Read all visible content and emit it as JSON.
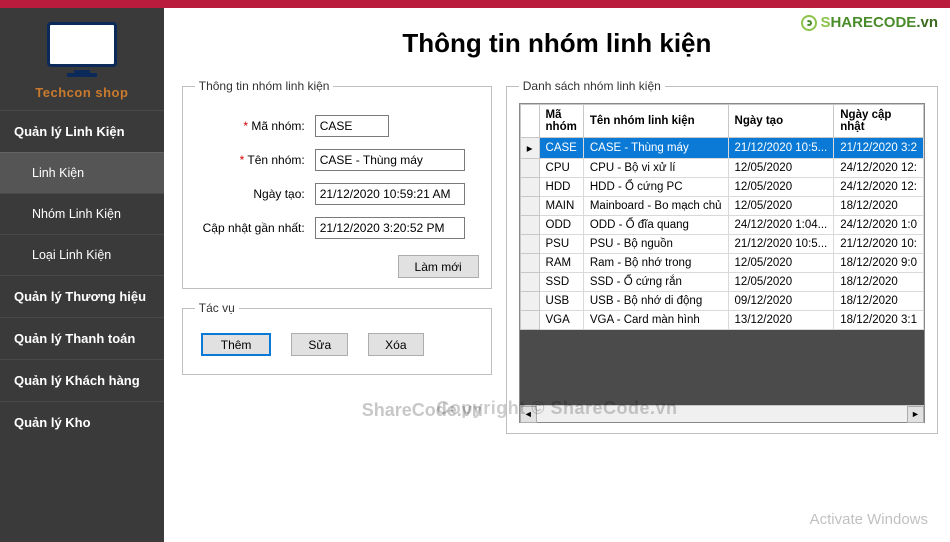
{
  "brand": {
    "name": "Techcon shop"
  },
  "sidebar_items": [
    {
      "label": "Quản lý Linh Kiện",
      "indent": false,
      "active": false
    },
    {
      "label": "Linh Kiện",
      "indent": true,
      "active": true
    },
    {
      "label": "Nhóm Linh Kiện",
      "indent": true,
      "active": false
    },
    {
      "label": "Loại Linh Kiện",
      "indent": true,
      "active": false
    },
    {
      "label": "Quản lý Thương hiệu",
      "indent": false,
      "active": false
    },
    {
      "label": "Quản lý Thanh toán",
      "indent": false,
      "active": false
    },
    {
      "label": "Quản lý Khách hàng",
      "indent": false,
      "active": false
    },
    {
      "label": "Quản lý Kho",
      "indent": false,
      "active": false
    }
  ],
  "page_title": "Thông tin nhóm linh kiện",
  "form": {
    "legend": "Thông tin nhóm linh kiện",
    "labels": {
      "ma": "Mã nhóm:",
      "ten": "Tên nhóm:",
      "ngaytao": "Ngày tạo:",
      "capnhat": "Cập nhật gần nhất:"
    },
    "values": {
      "ma": "CASE",
      "ten": "CASE - Thùng máy",
      "ngaytao": "21/12/2020 10:59:21 AM",
      "capnhat": "21/12/2020 3:20:52 PM"
    },
    "refresh_label": "Làm mới"
  },
  "tasks": {
    "legend": "Tác vụ",
    "add": "Thêm",
    "edit": "Sửa",
    "delete": "Xóa"
  },
  "grid": {
    "legend": "Danh sách nhóm linh kiện",
    "columns": {
      "ma": "Mã nhóm",
      "ten": "Tên nhóm linh kiện",
      "ngaytao": "Ngày tạo",
      "ngaycap": "Ngày cập nhật"
    },
    "rows": [
      {
        "ma": "CASE",
        "ten": "CASE - Thùng máy",
        "ngaytao": "21/12/2020 10:5...",
        "ngaycap": "21/12/2020 3:2",
        "sel": true
      },
      {
        "ma": "CPU",
        "ten": "CPU - Bộ vi xử lí",
        "ngaytao": "12/05/2020",
        "ngaycap": "24/12/2020 12:"
      },
      {
        "ma": "HDD",
        "ten": "HDD - Ổ cứng PC",
        "ngaytao": "12/05/2020",
        "ngaycap": "24/12/2020 12:"
      },
      {
        "ma": "MAIN",
        "ten": "Mainboard - Bo mạch chủ",
        "ngaytao": "12/05/2020",
        "ngaycap": "18/12/2020"
      },
      {
        "ma": "ODD",
        "ten": "ODD - Ổ đĩa quang",
        "ngaytao": "24/12/2020 1:04...",
        "ngaycap": "24/12/2020 1:0"
      },
      {
        "ma": "PSU",
        "ten": "PSU - Bộ nguồn",
        "ngaytao": "21/12/2020 10:5...",
        "ngaycap": "21/12/2020 10:"
      },
      {
        "ma": "RAM",
        "ten": "Ram - Bộ nhớ trong",
        "ngaytao": "12/05/2020",
        "ngaycap": "18/12/2020 9:0"
      },
      {
        "ma": "SSD",
        "ten": "SSD - Ổ cứng rắn",
        "ngaytao": "12/05/2020",
        "ngaycap": "18/12/2020"
      },
      {
        "ma": "USB",
        "ten": "USB - Bộ nhớ di động",
        "ngaytao": "09/12/2020",
        "ngaycap": "18/12/2020"
      },
      {
        "ma": "VGA",
        "ten": "VGA - Card màn hình",
        "ngaytao": "13/12/2020",
        "ngaycap": "18/12/2020 3:1"
      }
    ]
  },
  "watermarks": {
    "logo_s": "S",
    "logo_hare": "HARE",
    "logo_code": "CODE",
    "logo_vn": ".vn",
    "center": "Copyright © ShareCode.vn",
    "share2": "ShareCode.vn",
    "activate": "Activate Windows"
  }
}
